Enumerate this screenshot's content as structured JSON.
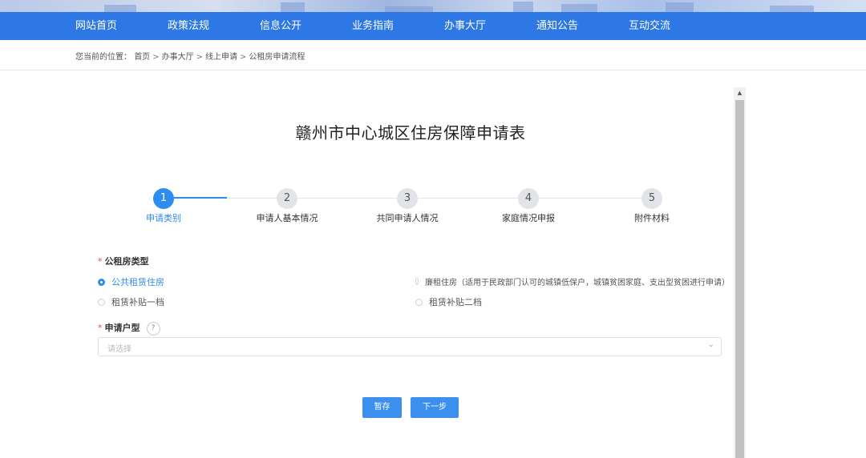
{
  "nav": {
    "items": [
      "网站首页",
      "政策法规",
      "信息公开",
      "业务指南",
      "办事大厅",
      "通知公告",
      "互动交流"
    ]
  },
  "breadcrumb": {
    "prefix": "您当前的位置：",
    "items": [
      "首页",
      "办事大厅",
      "线上申请",
      "公租房申请流程"
    ],
    "separator": ">"
  },
  "form": {
    "title": "赣州市中心城区住房保障申请表",
    "steps": [
      {
        "num": "1",
        "label": "申请类别",
        "active": true
      },
      {
        "num": "2",
        "label": "申请人基本情况",
        "active": false
      },
      {
        "num": "3",
        "label": "共同申请人情况",
        "active": false
      },
      {
        "num": "4",
        "label": "家庭情况申报",
        "active": false
      },
      {
        "num": "5",
        "label": "附件材料",
        "active": false
      }
    ],
    "housing_type": {
      "required_mark": "*",
      "label": "公租房类型",
      "options": [
        {
          "text": "公共租赁住房",
          "checked": true
        },
        {
          "text": "廉租住房（适用于民政部门认可的城镇低保户，城镇贫困家庭、支出型贫困进行申请）",
          "checked": false
        },
        {
          "text": "租赁补贴一档",
          "checked": false
        },
        {
          "text": "租赁补贴二档",
          "checked": false
        }
      ]
    },
    "unit_type": {
      "required_mark": "*",
      "label": "申请户型",
      "help": "?",
      "placeholder": "请选择",
      "chevron": "⌄"
    },
    "buttons": {
      "save": "暂存",
      "next": "下一步"
    }
  },
  "scrollbar": {
    "up_arrow": "▲"
  },
  "colors": {
    "nav_bg": "#2d78e4",
    "accent": "#2d8cf0",
    "button": "#3d8fee",
    "required": "#e84b4b"
  }
}
